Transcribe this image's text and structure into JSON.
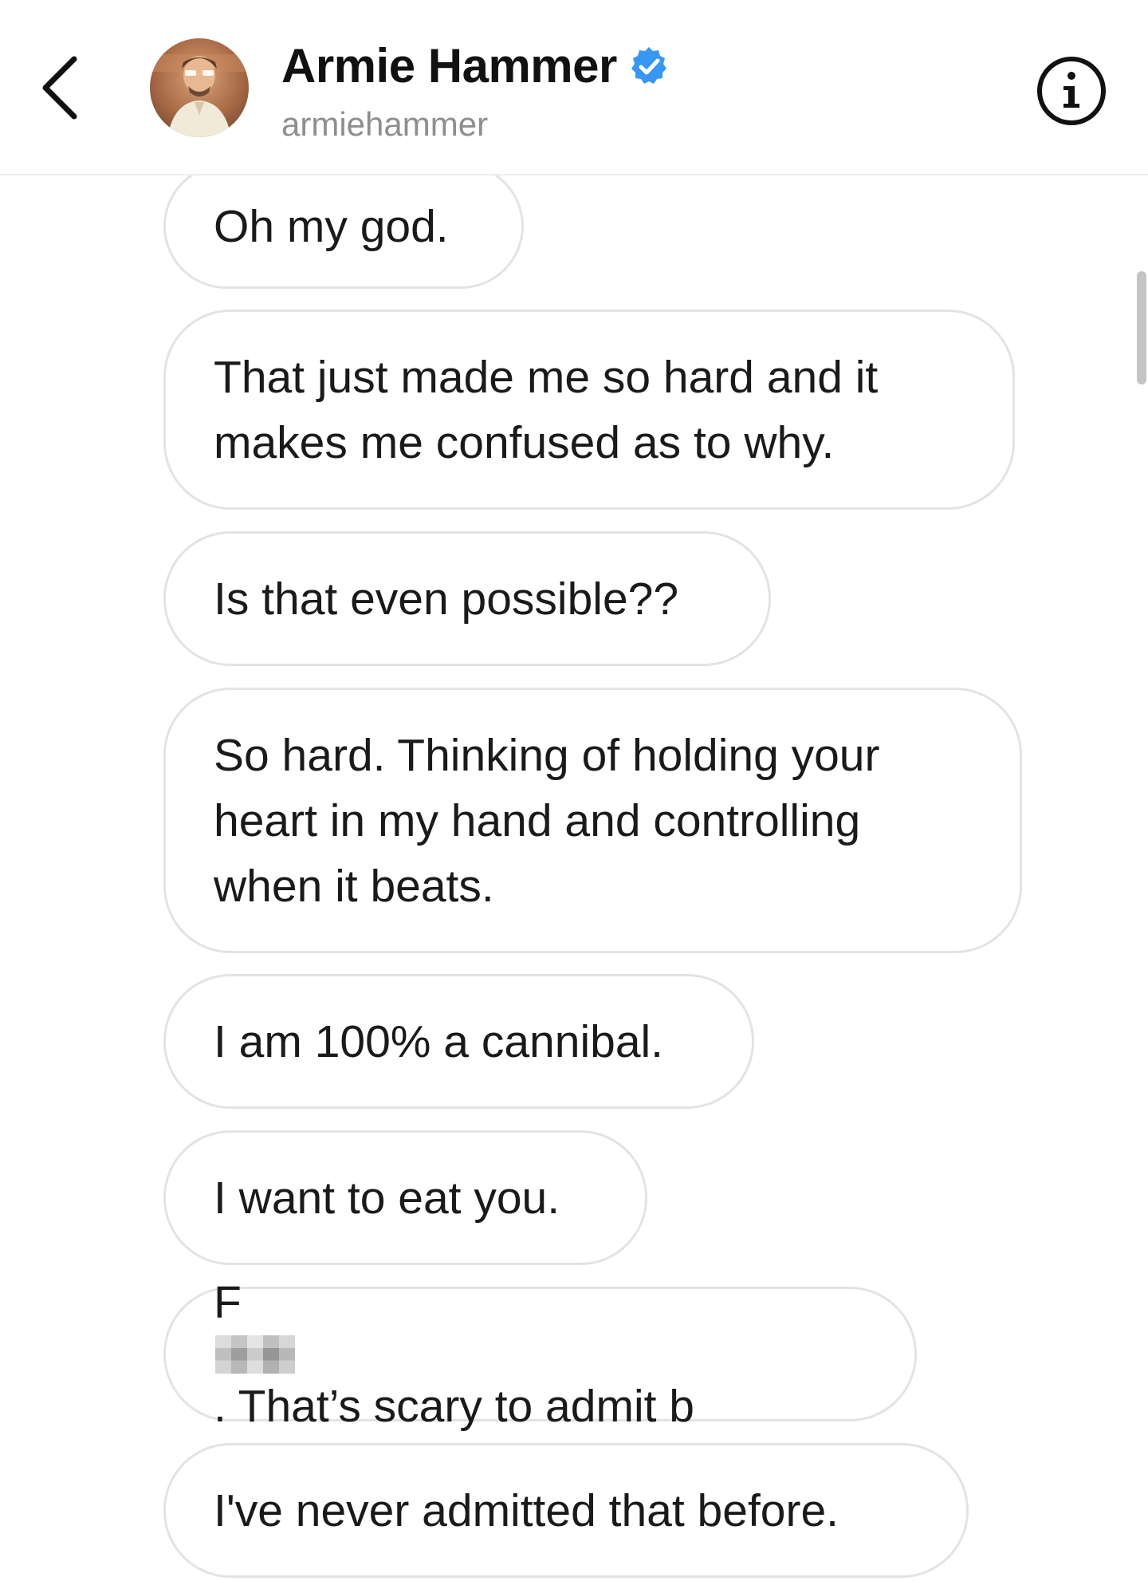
{
  "header": {
    "name": "Armie Hammer",
    "handle": "armiehammer",
    "back_icon": "chevron-left-icon",
    "verified_icon": "verified-badge-icon",
    "info_icon": "info-icon",
    "verified_color": "#3897f0"
  },
  "messages": [
    {
      "text": "Oh my god."
    },
    {
      "text": "That just made me so hard and it makes me confused as to why."
    },
    {
      "text": "Is that even possible??"
    },
    {
      "text": "So hard. Thinking of holding your heart in my hand and controlling when it beats."
    },
    {
      "text": "I am 100% a cannibal."
    },
    {
      "text": "I want to eat you."
    },
    {
      "text_before": "F",
      "text_after": ". That’s scary to admit b"
    },
    {
      "text": "I've never admitted that before."
    }
  ]
}
